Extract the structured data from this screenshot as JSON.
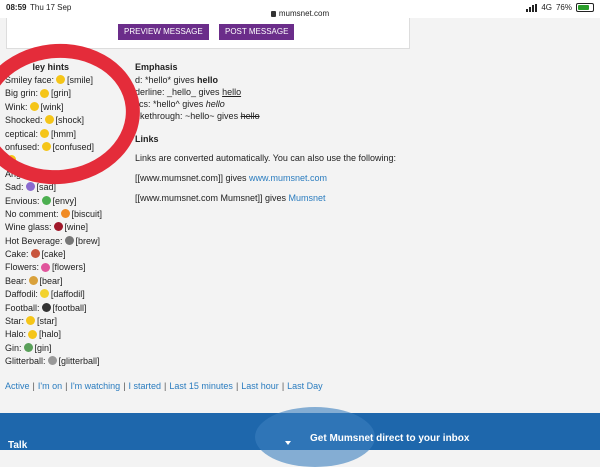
{
  "status": {
    "time": "08:59",
    "date": "Thu 17 Sep",
    "url": "mumsnet.com",
    "network": "4G",
    "battery": "76%"
  },
  "buttons": {
    "preview": "PREVIEW MESSAGE",
    "post": "POST MESSAGE"
  },
  "smiley": {
    "heading": "ley hints",
    "items": [
      {
        "name": "Smiley face:",
        "code": "[smile]",
        "icon": "smile-icon",
        "color": "#f5c518"
      },
      {
        "name": "Big grin:",
        "code": "[grin]",
        "icon": "grin-icon",
        "color": "#f5c518"
      },
      {
        "name": "Wink:",
        "code": "[wink]",
        "icon": "wink-icon",
        "color": "#f5c518"
      },
      {
        "name": "Shocked:",
        "code": "[shock]",
        "icon": "shock-icon",
        "color": "#f5c518"
      },
      {
        "name": "ceptical:",
        "code": "[hmm]",
        "icon": "hmm-icon",
        "color": "#f5c518"
      },
      {
        "name": "onfused:",
        "code": "[confused]",
        "icon": "confused-icon",
        "color": "#f5c518"
      },
      {
        "name": "",
        "code": "",
        "icon": "hidden-icon",
        "color": "#f5c518"
      },
      {
        "name": "Angry:",
        "code": "",
        "icon": "angry-icon",
        "color": "#e04040"
      },
      {
        "name": "Sad:",
        "code": "[sad]",
        "icon": "sad-icon",
        "color": "#8a6ad0"
      },
      {
        "name": "Envious:",
        "code": "[envy]",
        "icon": "envy-icon",
        "color": "#4caf50"
      },
      {
        "name": "No comment:",
        "code": "[biscuit]",
        "icon": "biscuit-icon",
        "color": "#f08a24"
      },
      {
        "name": "Wine glass:",
        "code": "[wine]",
        "icon": "wine-icon",
        "color": "#a0182a"
      },
      {
        "name": "Hot Beverage:",
        "code": "[brew]",
        "icon": "brew-icon",
        "color": "#777777"
      },
      {
        "name": "Cake:",
        "code": "[cake]",
        "icon": "cake-icon",
        "color": "#c8553d"
      },
      {
        "name": "Flowers:",
        "code": "[flowers]",
        "icon": "flowers-icon",
        "color": "#e0559c"
      },
      {
        "name": "Bear:",
        "code": "[bear]",
        "icon": "bear-icon",
        "color": "#d9a13b"
      },
      {
        "name": "Daffodil:",
        "code": "[daffodil]",
        "icon": "daffodil-icon",
        "color": "#f2d22e"
      },
      {
        "name": "Football:",
        "code": "[football]",
        "icon": "football-icon",
        "color": "#333333"
      },
      {
        "name": "Star:",
        "code": "[star]",
        "icon": "star-icon",
        "color": "#f5c518"
      },
      {
        "name": "Halo:",
        "code": "[halo]",
        "icon": "halo-icon",
        "color": "#f5c518"
      },
      {
        "name": "Gin:",
        "code": "[gin]",
        "icon": "gin-icon",
        "color": "#5aa05a"
      },
      {
        "name": "Glitterball:",
        "code": "[glitterball]",
        "icon": "glitterball-icon",
        "color": "#999999"
      }
    ]
  },
  "emphasis": {
    "heading": "Emphasis",
    "bold": {
      "prefix": "d: *hello* gives ",
      "sample": "hello"
    },
    "underline": {
      "prefix": "derline: _hello_ gives ",
      "sample": "hello"
    },
    "italic": {
      "prefix": "lics: *hello^ gives ",
      "sample": "hello"
    },
    "strike": {
      "prefix": "rikethrough: ~hello~ gives ",
      "sample": "hello"
    }
  },
  "links": {
    "heading": "Links",
    "intro": "Links are converted automatically. You can also use the following:",
    "ex1_prefix": "[[www.mumsnet.com]] gives ",
    "ex1_link": "www.mumsnet.com",
    "ex2_prefix": "[[www.mumsnet.com Mumsnet]] gives ",
    "ex2_link": "Mumsnet"
  },
  "nav": [
    "Active",
    "I'm on",
    "I'm watching",
    "I started",
    "Last 15 minutes",
    "Last hour",
    "Last Day"
  ],
  "footer": {
    "talk": "Talk",
    "newsletter": "Get Mumsnet direct to your inbox"
  },
  "colors": {
    "accent_purple": "#6b2d8a",
    "link_blue": "#2a7cbf",
    "footer_blue": "#1e67ac",
    "annotation_red": "#e42c3a"
  }
}
